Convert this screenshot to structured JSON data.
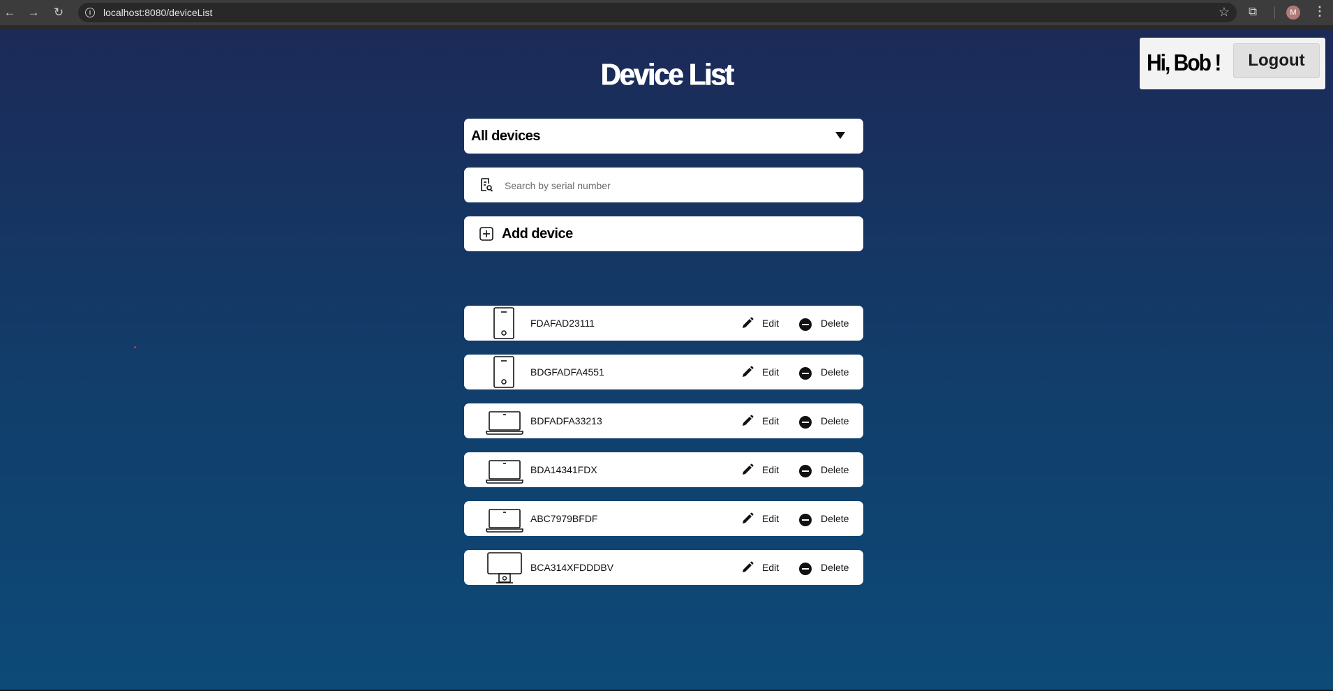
{
  "browser": {
    "url": "localhost:8080/deviceList",
    "avatar_letter": "M"
  },
  "page": {
    "title": "Device List",
    "greeting": "Hi, Bob !",
    "logout_label": "Logout",
    "filter_selected": "All devices",
    "search_placeholder": "Search by serial number",
    "add_label": "Add device",
    "edit_label": "Edit",
    "delete_label": "Delete"
  },
  "devices": [
    {
      "serial": "FDAFAD23111",
      "type": "phone-icon"
    },
    {
      "serial": "BDGFADFA4551",
      "type": "phone-icon"
    },
    {
      "serial": "BDFADFA33213",
      "type": "laptop-icon"
    },
    {
      "serial": "BDA14341FDX",
      "type": "laptop-icon"
    },
    {
      "serial": "ABC7979BFDF",
      "type": "laptop-icon"
    },
    {
      "serial": "BCA314XFDDDBV",
      "type": "monitor-icon"
    }
  ]
}
